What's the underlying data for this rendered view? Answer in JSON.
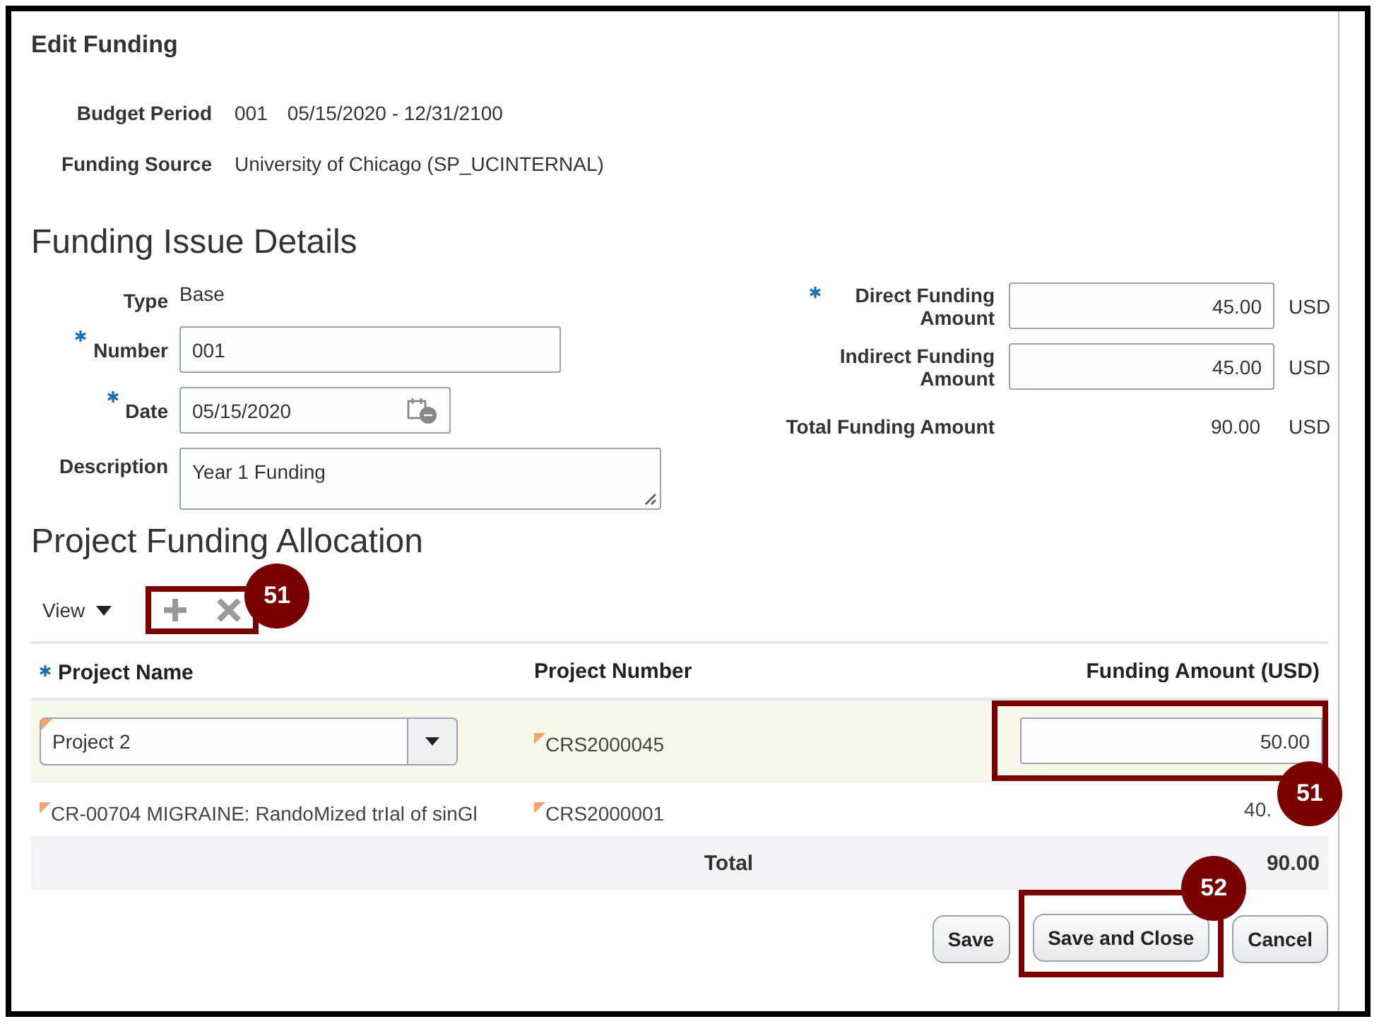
{
  "title": "Edit Funding",
  "summary": [
    {
      "label": "Budget Period",
      "values": [
        "001",
        "05/15/2020 - 12/31/2100"
      ]
    },
    {
      "label": "Funding Source",
      "values": [
        "University of Chicago (SP_UCINTERNAL)"
      ]
    }
  ],
  "issue_details": {
    "heading": "Funding Issue Details",
    "left": [
      {
        "kind": "text",
        "label": "Type",
        "required": false,
        "value": "Base"
      },
      {
        "kind": "input",
        "label": "Number",
        "required": true,
        "value": "001"
      },
      {
        "kind": "date",
        "label": "Date",
        "required": true,
        "value": "05/15/2020"
      },
      {
        "kind": "textarea",
        "label": "Description",
        "required": false,
        "value": "Year 1 Funding"
      }
    ],
    "right": [
      {
        "kind": "input",
        "label": "Direct Funding Amount",
        "required": true,
        "value": "45.00",
        "currency": "USD"
      },
      {
        "kind": "input",
        "label": "Indirect Funding Amount",
        "required": false,
        "value": "45.00",
        "currency": "USD"
      },
      {
        "kind": "text",
        "label": "Total Funding Amount",
        "required": false,
        "value": "90.00",
        "currency": "USD"
      }
    ]
  },
  "allocation": {
    "heading": "Project Funding Allocation",
    "toolbar": {
      "view": "View",
      "callout": "51"
    },
    "columns": [
      {
        "label": "Project Name",
        "required": true
      },
      {
        "label": "Project Number",
        "required": false
      },
      {
        "label": "Funding Amount (USD)",
        "required": false
      }
    ],
    "rows": [
      {
        "selected": true,
        "kind": "edit",
        "project_name": "Project 2",
        "project_number": "CRS2000045",
        "amount": "50.00",
        "changed": true,
        "callout": "51"
      },
      {
        "selected": false,
        "kind": "read",
        "project_name": "CR-00704 MIGRAINE: RandoMized trIal of sinGl",
        "project_number": "CRS2000001",
        "amount": "40.",
        "changed": true
      }
    ],
    "total": {
      "label": "Total",
      "value": "90.00"
    }
  },
  "buttons": [
    {
      "label": "Save"
    },
    {
      "label": "Save and Close",
      "callout": "52"
    },
    {
      "label": "Cancel"
    }
  ]
}
